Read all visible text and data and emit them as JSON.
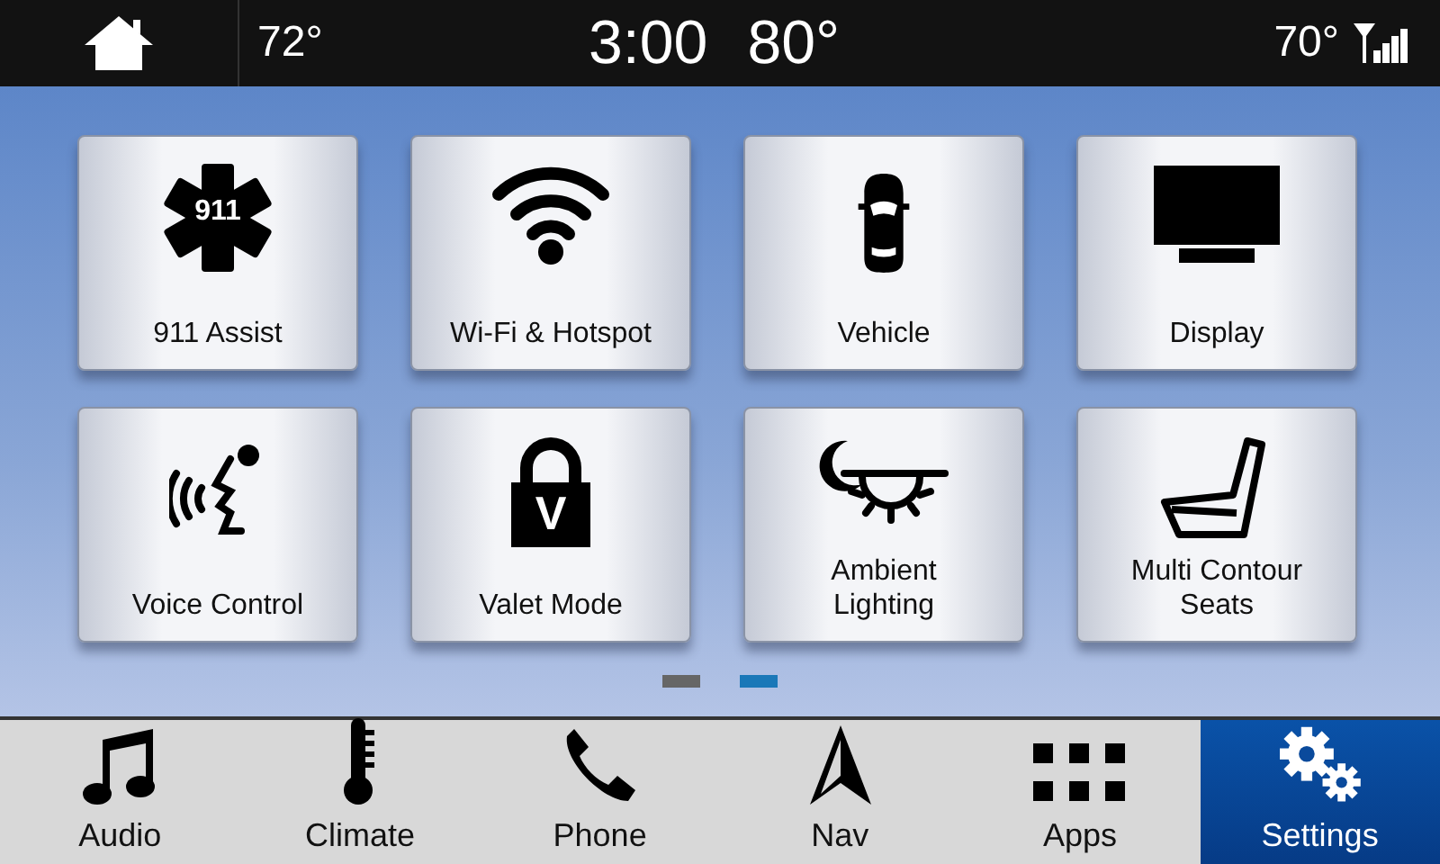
{
  "status_bar": {
    "left_temp": "72°",
    "clock": "3:00",
    "outside_temp": "80°",
    "right_temp": "70°"
  },
  "tiles": [
    {
      "label": "911 Assist",
      "kind": "star",
      "badge": "911"
    },
    {
      "label": "Wi-Fi & Hotspot",
      "kind": "wifi"
    },
    {
      "label": "Vehicle",
      "kind": "car"
    },
    {
      "label": "Display",
      "kind": "monitor"
    },
    {
      "label": "Voice Control",
      "kind": "voice"
    },
    {
      "label": "Valet Mode",
      "kind": "lock",
      "badge": "V"
    },
    {
      "label": "Ambient\nLighting",
      "kind": "lamp"
    },
    {
      "label": "Multi Contour\nSeats",
      "kind": "seat"
    }
  ],
  "pages": [
    {
      "selected": false
    },
    {
      "selected": true
    }
  ],
  "nav_tabs": [
    {
      "label": "Audio",
      "kind": "music",
      "selected": false
    },
    {
      "label": "Climate",
      "kind": "thermometer",
      "selected": false
    },
    {
      "label": "Phone",
      "kind": "phone",
      "selected": false
    },
    {
      "label": "Nav",
      "kind": "arrow",
      "selected": false
    },
    {
      "label": "Apps",
      "kind": "grid",
      "selected": false
    },
    {
      "label": "Settings",
      "kind": "gears",
      "selected": true
    }
  ]
}
